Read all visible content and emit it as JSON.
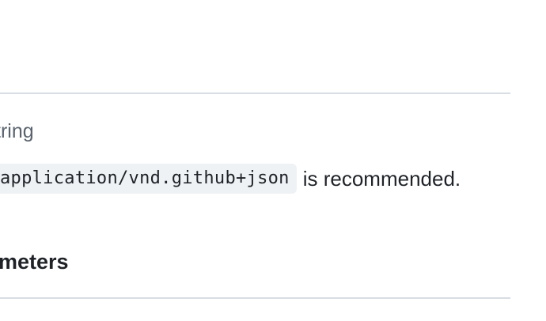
{
  "header_param": {
    "type": "tring",
    "description_code": "application/vnd.github+json",
    "description_rest": "is recommended."
  },
  "section": {
    "heading": "meters"
  }
}
